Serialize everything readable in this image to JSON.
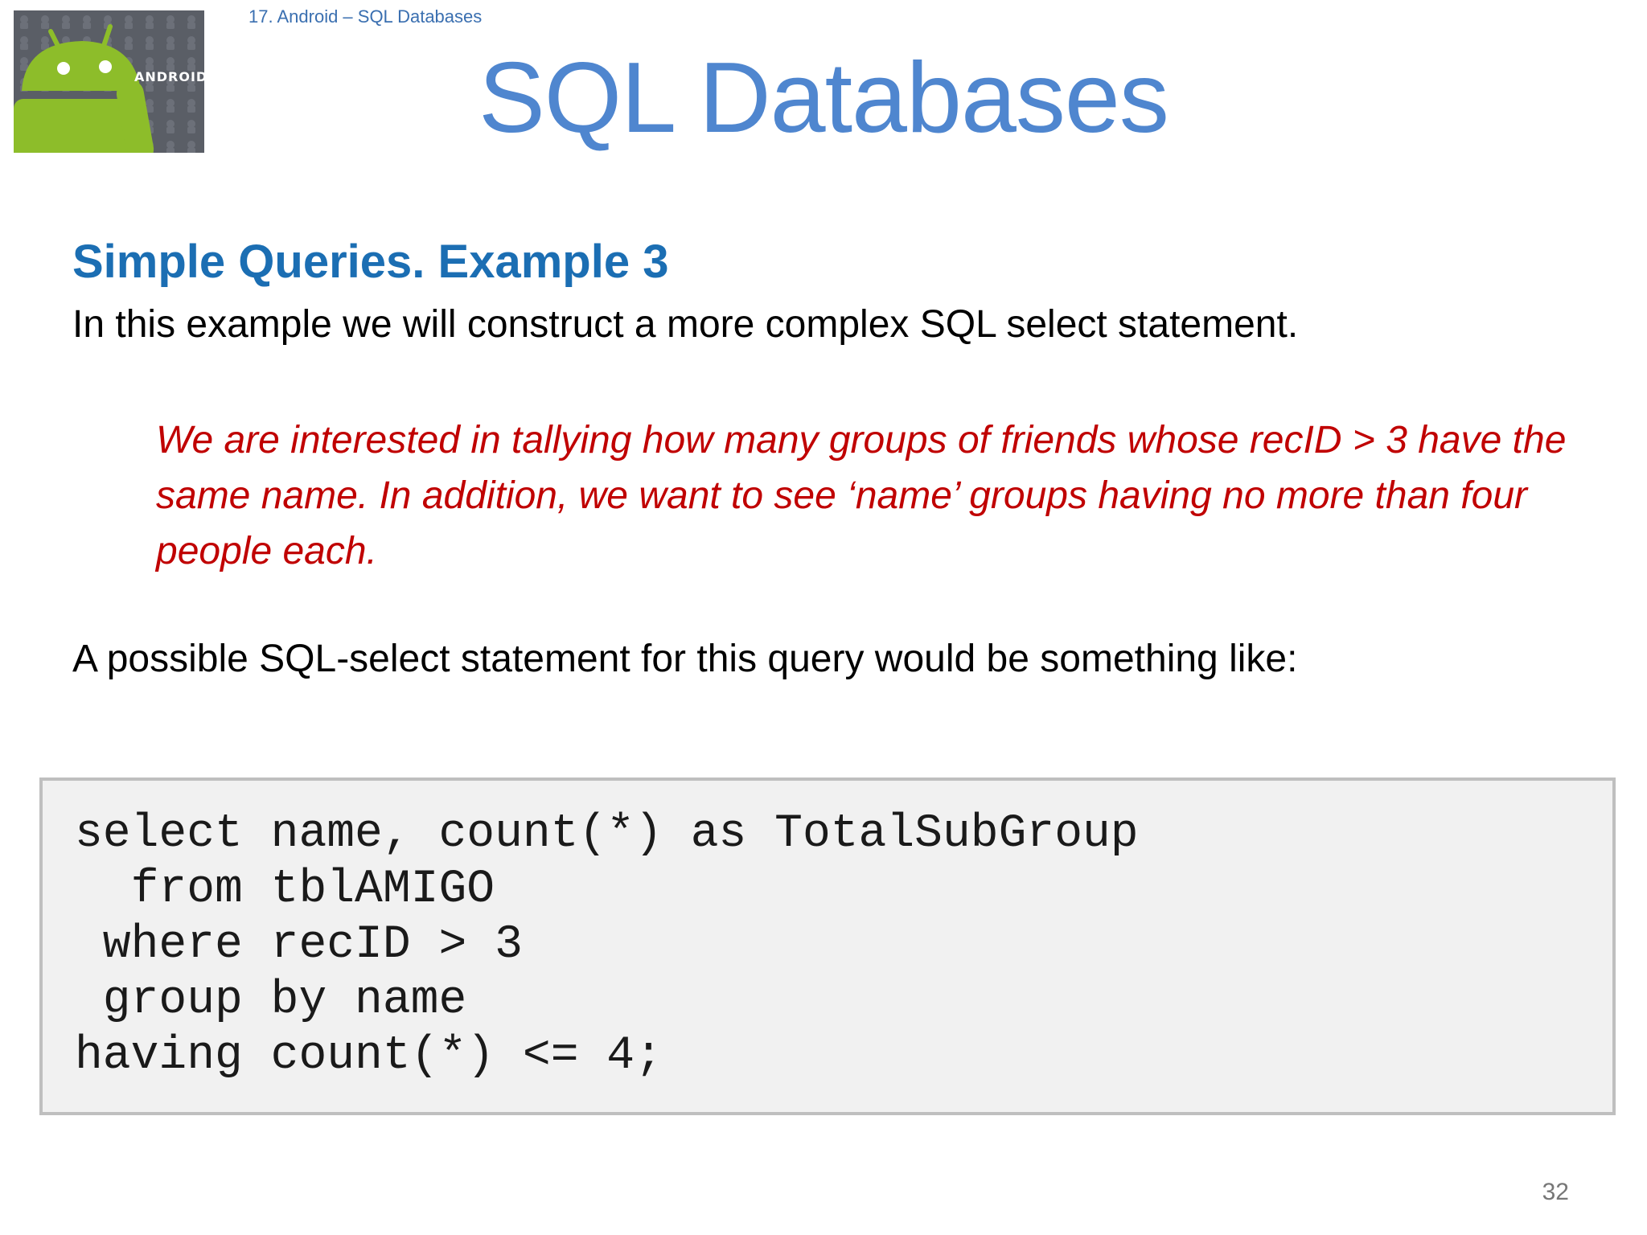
{
  "header": {
    "breadcrumb": "17. Android – SQL Databases",
    "title": "SQL Databases",
    "logo": {
      "icon": "android-robot-icon",
      "text": "android"
    }
  },
  "content": {
    "section_heading": "Simple Queries. Example 3",
    "intro": "In this example we will construct a more complex SQL select statement.",
    "goal": "We are interested in tallying how many groups of friends whose recID > 3 have the same name. In addition, we want to see ‘name’ groups having no more than four people each.",
    "lead_in": "A possible SQL-select statement for this query would be something like:"
  },
  "code_block": {
    "lines": [
      "select name, count(*) as TotalSubGroup",
      "  from tblAMIGO",
      " where recID > 3",
      " group by name",
      "having count(*) <= 4;"
    ]
  },
  "footer": {
    "page_number": "32"
  },
  "colors": {
    "title": "#4f86cf",
    "heading": "#1b6eb3",
    "emphasis": "#c00000",
    "code_background": "#f1f1f1",
    "android_green": "#8dbd2a"
  }
}
